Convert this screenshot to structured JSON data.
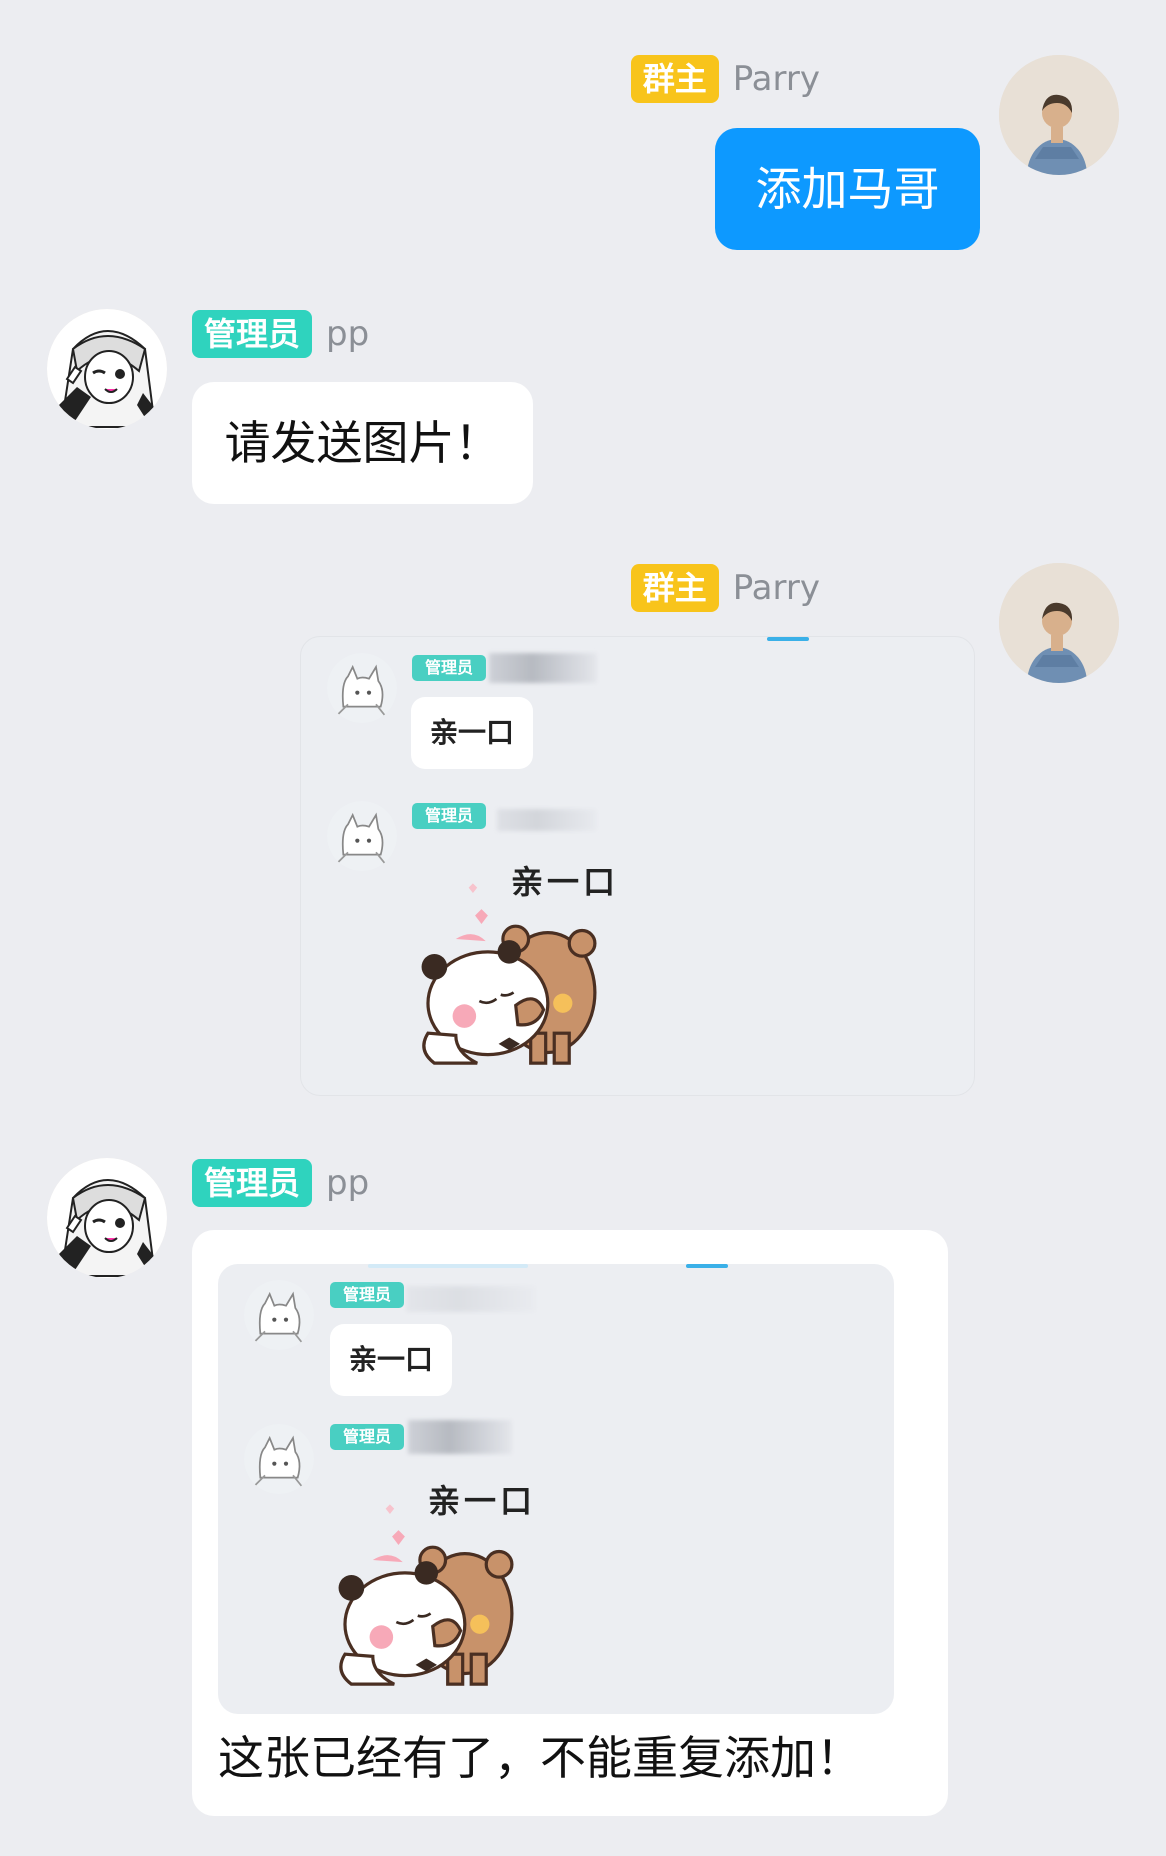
{
  "messages": [
    {
      "role": "owner",
      "badge": "群主",
      "name": "Parry",
      "text": "添加马哥"
    },
    {
      "role": "admin",
      "badge": "管理员",
      "name": "pp",
      "text": "请发送图片！"
    },
    {
      "role": "owner",
      "badge": "群主",
      "name": "Parry",
      "image": {
        "badge": "管理员",
        "bubble_text": "亲一口",
        "sticker_text": "亲一口"
      }
    },
    {
      "role": "admin",
      "badge": "管理员",
      "name": "pp",
      "image": {
        "badge": "管理员",
        "bubble_text": "亲一口",
        "sticker_text": "亲一口"
      },
      "text": "这张已经有了，不能重复添加！"
    }
  ],
  "icons": {
    "owner_avatar": "person-back-view-avatar",
    "admin_avatar": "anime-girl-avatar",
    "mini_avatar": "cat-sketch-avatar",
    "sticker": "panda-bear-kiss-sticker"
  },
  "colors": {
    "background": "#ecedf1",
    "owner_badge": "#f8c41b",
    "admin_badge": "#2fd3be",
    "self_bubble": "#0d99ff",
    "other_bubble": "#ffffff",
    "nickname": "#8b8f96"
  }
}
